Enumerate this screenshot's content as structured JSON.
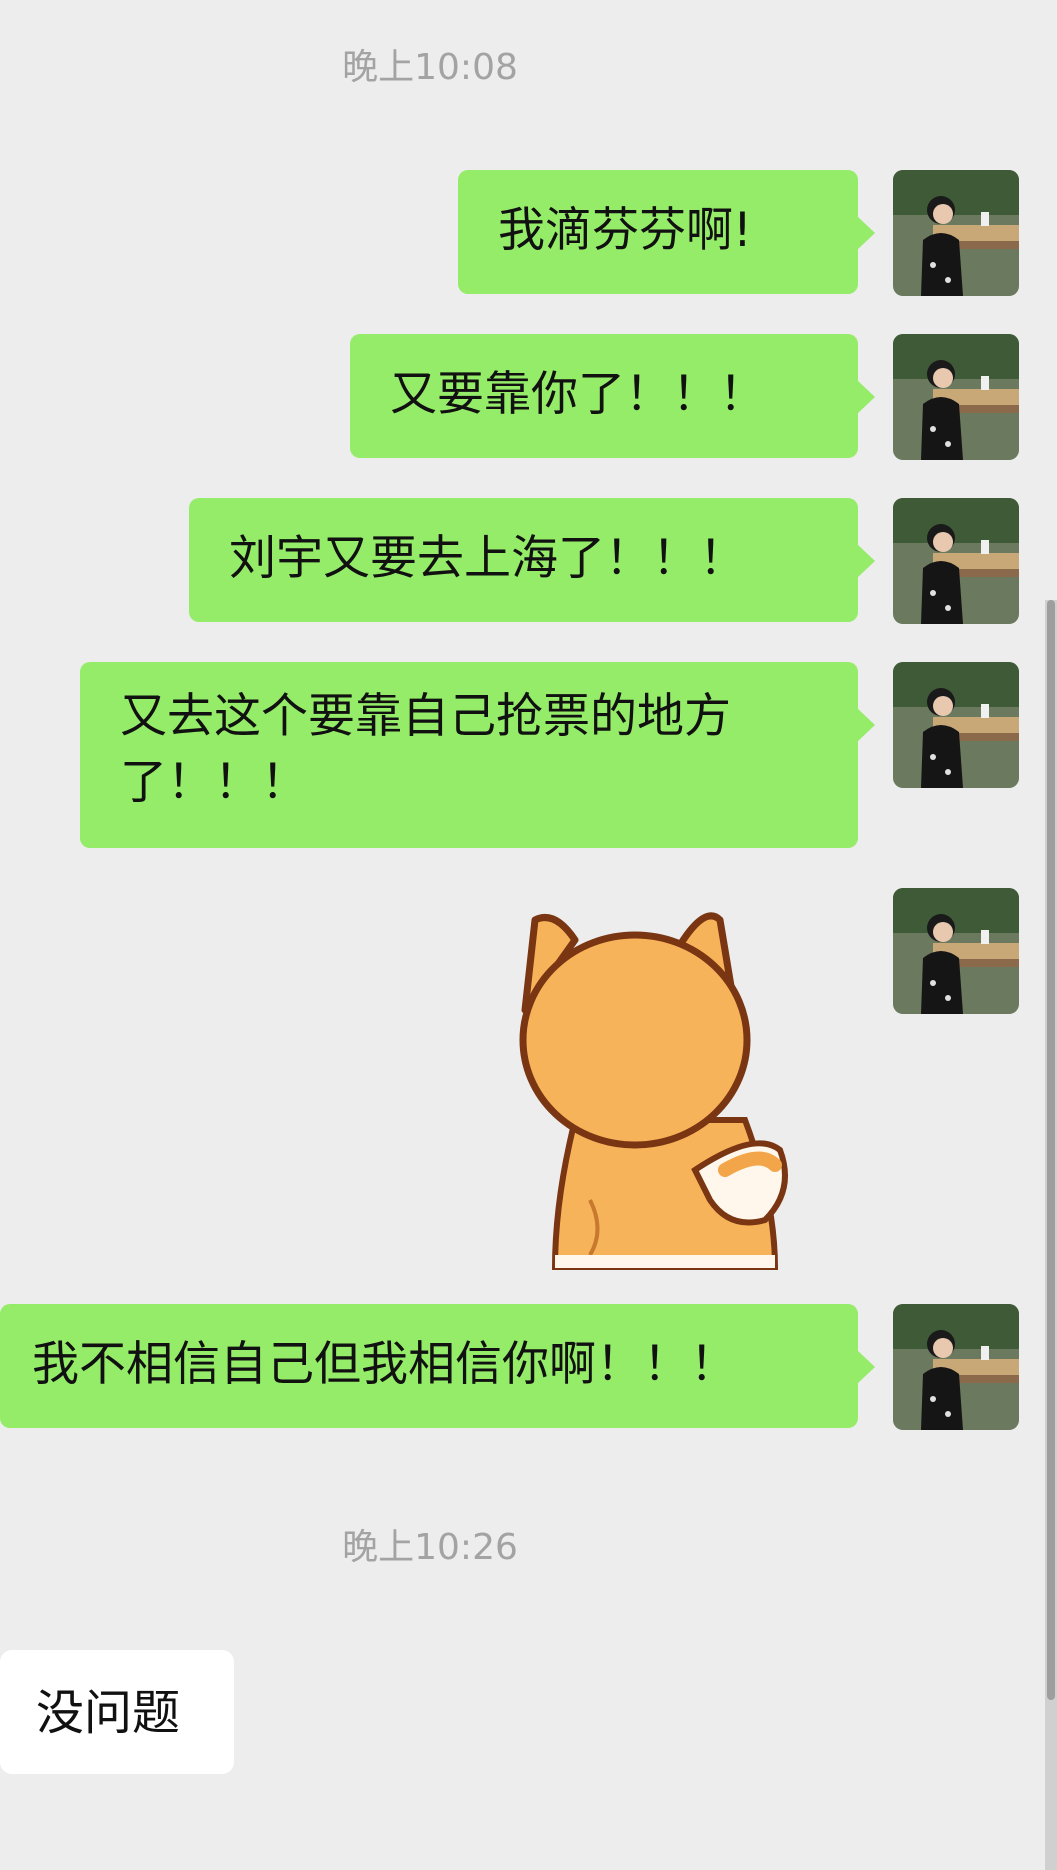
{
  "timestamps": [
    "晚上10:08",
    "晚上10:26"
  ],
  "outgoing_messages": [
    "我滴芬芬啊!",
    "又要靠你了！！！",
    "刘宇又要去上海了！！！",
    "又去这个要靠自己抢票的地方\n了！！！",
    "我不相信自己但我相信你啊！！！"
  ],
  "sticker": {
    "icon": "shiba-dog-sticker-icon"
  },
  "incoming_messages": [
    "没问题"
  ],
  "colors": {
    "background": "#ededed",
    "outgoing_bubble": "#95ec69",
    "incoming_bubble": "#ffffff",
    "timestamp_text": "#a3a3a3"
  }
}
